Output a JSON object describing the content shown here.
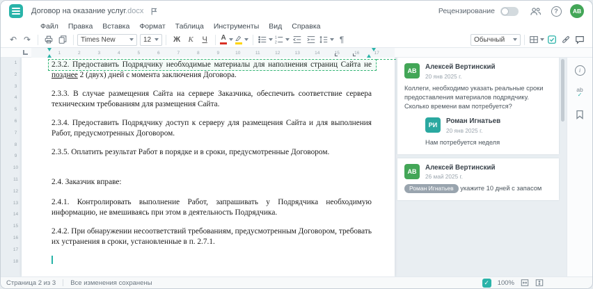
{
  "window": {
    "title": "Договор на оказание услуг",
    "title_ext": ".docx"
  },
  "header": {
    "review_label": "Рецензирование",
    "avatar_initials": "АВ"
  },
  "menu": {
    "items": [
      "Файл",
      "Правка",
      "Вставка",
      "Формат",
      "Таблица",
      "Инструменты",
      "Вид",
      "Справка"
    ]
  },
  "toolbar": {
    "font_name": "Times New",
    "font_size": "12",
    "bold": "Ж",
    "italic": "К",
    "underline": "Ч",
    "color_letter": "А",
    "style_name": "Обычный"
  },
  "icons": {
    "undo": "↶",
    "redo": "↷",
    "pilcrow": "¶",
    "help": "?",
    "info": "i",
    "spell": "ab",
    "check": "✓"
  },
  "ruler": {
    "h_numbers": [
      "1",
      "2",
      "3",
      "4",
      "5",
      "6",
      "7",
      "8",
      "9",
      "10",
      "11",
      "12",
      "13",
      "14",
      "15",
      "16",
      "17"
    ],
    "v_numbers": [
      "1",
      "2",
      "3",
      "4",
      "5",
      "6",
      "7",
      "8",
      "9",
      "10",
      "11",
      "12",
      "13",
      "14",
      "15",
      "16",
      "17",
      "18"
    ]
  },
  "document": {
    "p1_before": "2.3.2. Предоставить Подрядчику необходимые материалы для наполнения страниц Сайта не ",
    "p1_ins": "позднее",
    "p1_after": " 2 (двух) дней с момента заключения Договора.",
    "p2": "2.3.3. В случае размещения Сайта на сервере Заказчика, обеспечить соответствие сервера техническим требованиям для размещения Сайта.",
    "p3": "2.3.4. Предоставить Подрядчику доступ к серверу для размещения Сайта и для выполнения Работ, предусмотренных Договором.",
    "p4": "2.3.5. Оплатить результат Работ в порядке и в сроки, предусмотренные Договором.",
    "p5": "2.4. Заказчик вправе:",
    "p6": "2.4.1. Контролировать выполнение Работ, запрашивать у Подрядчика необходимую информацию, не вмешиваясь при этом в деятельность Подрядчика.",
    "p7": "2.4.2. При обнаружении несоответствий требованиям, предусмотренным Договором, требовать их устранения в сроки, установленные в п. 2.7.1."
  },
  "comments": {
    "c1": {
      "initials": "АВ",
      "name": "Алексей Вертинский",
      "date": "20 янв 2025 г.",
      "text": "Коллеги, необходимо указать реальные сроки предоставления материалов подрядчику. Сколько времени вам потребуется?"
    },
    "r1": {
      "initials": "РИ",
      "name": "Роман Игнатьев",
      "date": "20 янв 2025 г.",
      "text": "Нам потребуется неделя"
    },
    "c2": {
      "initials": "АВ",
      "name": "Алексей Вертинский",
      "date": "26 май 2025 г.",
      "mention": "Роман Игнатьев",
      "text": " укажите 10 дней с запасом"
    }
  },
  "statusbar": {
    "page": "Страница 2 из 3",
    "saved": "Все изменения сохранены",
    "zoom": "100%"
  },
  "colors": {
    "accent": "#2bb3a9",
    "avatar_green": "#43a657",
    "avatar_teal": "#2aa8a0",
    "change_green": "#34b575",
    "mention_bg": "#99a4ae",
    "font_color_bar": "#d93025",
    "highlight_bar": "#ffd400"
  }
}
